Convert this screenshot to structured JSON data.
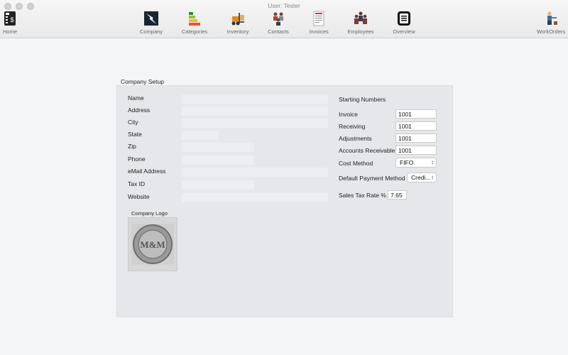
{
  "window": {
    "title": "User:  Tester"
  },
  "toolbar": {
    "home": "Home",
    "company": "Company",
    "categories": "Categories",
    "inventory": "Inventory",
    "contacts": "Contacts",
    "invoices": "Invoices",
    "employees": "Employees",
    "overview": "Overview",
    "workorders": "WorkOrders"
  },
  "setup": {
    "title": "Company Setup",
    "labels": {
      "name": "Name",
      "address": "Address",
      "city": "City",
      "state": "State",
      "zip": "Zip",
      "phone": "Phone",
      "email": "eMail Address",
      "tax_id": "Tax ID",
      "website": "Website"
    },
    "logo_label": "Company Logo",
    "logo_text": "M&M"
  },
  "numbers": {
    "title": "Starting Numbers",
    "invoice_label": "Invoice",
    "invoice_value": "1001",
    "receiving_label": "Receiving",
    "receiving_value": "1001",
    "adjustments_label": "Adjustments",
    "adjustments_value": "1001",
    "ar_label": "Accounts Receivable",
    "ar_value": "1001",
    "cost_method_label": "Cost Method",
    "cost_method_value": "FIFO",
    "payment_label": "Default Payment Method",
    "payment_value": "Credi...",
    "tax_rate_label": "Sales Tax Rate %",
    "tax_rate_value": "7.65"
  },
  "icons": {
    "home": "cash-register-icon",
    "company": "lightning-icon",
    "categories": "bar-stack-icon",
    "inventory": "forklift-icon",
    "contacts": "people-icon",
    "invoices": "document-icon",
    "employees": "team-icon",
    "overview": "overview-list-icon",
    "workorders": "worker-icon"
  }
}
